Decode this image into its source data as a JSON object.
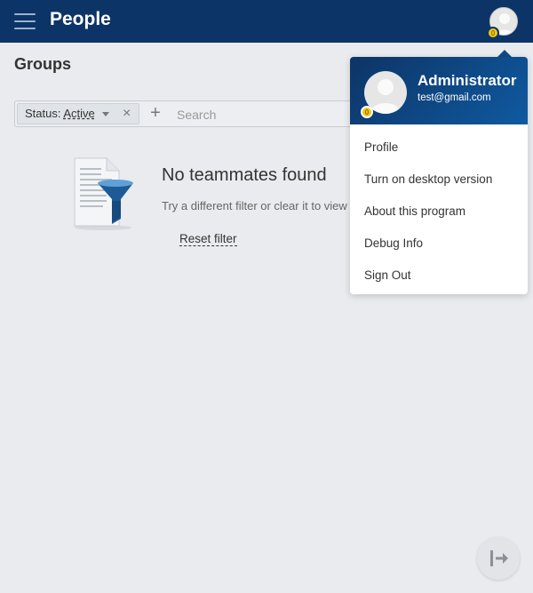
{
  "header": {
    "title": "People",
    "menu_icon": "hamburger-icon",
    "avatar_icon": "user-avatar-icon",
    "badge_color": "#f2c811",
    "bar_color": "#0d3466"
  },
  "page": {
    "title": "Groups"
  },
  "filter": {
    "status_label": "Status:",
    "status_value": "Active",
    "remove_symbol": "×",
    "add_symbol": "+",
    "search_placeholder": "Search"
  },
  "empty_state": {
    "title": "No teammates found",
    "description": "Try a different filter or clear it to view all",
    "reset_label": "Reset filter",
    "icon": "document-filter-icon"
  },
  "profile_menu": {
    "name": "Administrator",
    "email": "test@gmail.com",
    "items": [
      {
        "label": "Profile"
      },
      {
        "label": "Turn on desktop version"
      },
      {
        "label": "About this program"
      },
      {
        "label": "Debug Info"
      },
      {
        "label": "Sign Out"
      }
    ]
  },
  "fab": {
    "icon": "logout-icon"
  }
}
